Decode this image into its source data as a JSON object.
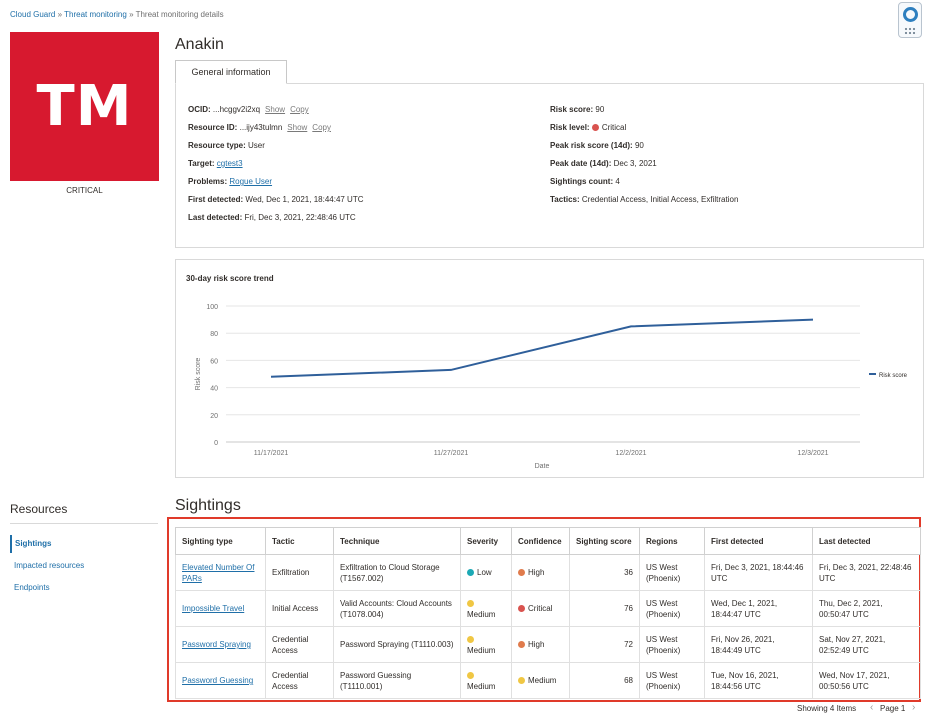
{
  "breadcrumb": {
    "items": [
      "Cloud Guard",
      "Threat monitoring",
      "Threat monitoring details"
    ],
    "separator": "»"
  },
  "badge": {
    "initials": "TM",
    "label": "CRITICAL",
    "color": "#d7192f"
  },
  "page_title": "Anakin",
  "tab_label": "General information",
  "info_left": {
    "ocid_label": "OCID:",
    "ocid_value": "...hcggv2i2xq",
    "ocid_show": "Show",
    "ocid_copy": "Copy",
    "resource_id_label": "Resource ID:",
    "resource_id_value": "...ijy43tulmn",
    "resource_id_show": "Show",
    "resource_id_copy": "Copy",
    "resource_type_label": "Resource type:",
    "resource_type_value": "User",
    "target_label": "Target:",
    "target_value": "cgtest3",
    "problems_label": "Problems:",
    "problems_value": "Rogue User",
    "first_detected_label": "First detected:",
    "first_detected_value": "Wed, Dec 1, 2021, 18:44:47 UTC",
    "last_detected_label": "Last detected:",
    "last_detected_value": "Fri, Dec 3, 2021, 22:48:46 UTC"
  },
  "info_right": {
    "risk_score_label": "Risk score:",
    "risk_score_value": "90",
    "risk_level_label": "Risk level:",
    "risk_level_value": "Critical",
    "peak_score_label": "Peak risk score (14d):",
    "peak_score_value": "90",
    "peak_date_label": "Peak date (14d):",
    "peak_date_value": "Dec 3, 2021",
    "sightings_count_label": "Sightings count:",
    "sightings_count_value": "4",
    "tactics_label": "Tactics:",
    "tactics_value": "Credential Access, Initial Access, Exfiltration"
  },
  "chart_data": {
    "type": "line",
    "title": "30-day risk score trend",
    "xlabel": "Date",
    "ylabel": "Risk score",
    "categories": [
      "11/17/2021",
      "11/27/2021",
      "12/2/2021",
      "12/3/2021"
    ],
    "series": [
      {
        "name": "Risk score",
        "values": [
          48,
          53,
          85,
          90
        ],
        "color": "#2f5f9a"
      }
    ],
    "y_ticks": [
      "0",
      "20",
      "40",
      "60",
      "80",
      "100"
    ],
    "ylim": [
      0,
      100
    ],
    "grid": true,
    "legend": "right"
  },
  "resources": {
    "title": "Resources",
    "items": [
      "Sightings",
      "Impacted resources",
      "Endpoints"
    ]
  },
  "sightings": {
    "title": "Sightings",
    "columns": [
      "Sighting type",
      "Tactic",
      "Technique",
      "Severity",
      "Confidence",
      "Sighting score",
      "Regions",
      "First detected",
      "Last detected"
    ],
    "rows": [
      {
        "type": "Elevated Number Of PARs",
        "tactic": "Exfiltration",
        "technique": "Exfiltration to Cloud Storage (T1567.002)",
        "severity": "Low",
        "severity_color": "#1ca9b5",
        "confidence": "High",
        "confidence_color": "#e07b4c",
        "score": "36",
        "region": "US West (Phoenix)",
        "first": "Fri, Dec 3, 2021, 18:44:46 UTC",
        "last": "Fri, Dec 3, 2021, 22:48:46 UTC"
      },
      {
        "type": "Impossible Travel",
        "tactic": "Initial Access",
        "technique": "Valid Accounts: Cloud Accounts (T1078.004)",
        "severity": "Medium",
        "severity_color": "#f0c744",
        "confidence": "Critical",
        "confidence_color": "#d9534f",
        "score": "76",
        "region": "US West (Phoenix)",
        "first": "Wed, Dec 1, 2021, 18:44:47 UTC",
        "last": "Thu, Dec 2, 2021, 00:50:47 UTC"
      },
      {
        "type": "Password Spraying",
        "tactic": "Credential Access",
        "technique": "Password Spraying (T1110.003)",
        "severity": "Medium",
        "severity_color": "#f0c744",
        "confidence": "High",
        "confidence_color": "#e07b4c",
        "score": "72",
        "region": "US West (Phoenix)",
        "first": "Fri, Nov 26, 2021, 18:44:49 UTC",
        "last": "Sat, Nov 27, 2021, 02:52:49 UTC"
      },
      {
        "type": "Password Guessing",
        "tactic": "Credential Access",
        "technique": "Password Guessing (T1110.001)",
        "severity": "Medium",
        "severity_color": "#f0c744",
        "confidence": "Medium",
        "confidence_color": "#f0c744",
        "score": "68",
        "region": "US West (Phoenix)",
        "first": "Tue, Nov 16, 2021, 18:44:56 UTC",
        "last": "Wed, Nov 17, 2021, 00:50:56 UTC"
      }
    ]
  },
  "footer": {
    "showing": "Showing 4 Items",
    "page": "Page 1"
  },
  "colors": {
    "accent": "#1f6fa8",
    "critical": "#d9534f",
    "highlight_border": "#e03a2a"
  }
}
